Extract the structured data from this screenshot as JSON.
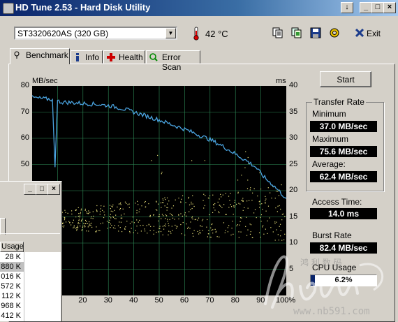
{
  "window": {
    "title": "HD Tune 2.53 - Hard Disk Utility"
  },
  "toolbar": {
    "drive": "ST3320620AS (320 GB)",
    "temperature": "42 °C",
    "exit_label": "Exit"
  },
  "tabs": [
    {
      "label": "Benchmark",
      "icon": "benchmark-icon"
    },
    {
      "label": "Info",
      "icon": "info-icon"
    },
    {
      "label": "Health",
      "icon": "health-icon"
    },
    {
      "label": "Error Scan",
      "icon": "error-scan-icon"
    }
  ],
  "side": {
    "start_label": "Start",
    "transfer_rate_title": "Transfer Rate",
    "minimum_label": "Minimum",
    "minimum_value": "37.0 MB/sec",
    "maximum_label": "Maximum",
    "maximum_value": "75.6 MB/sec",
    "average_label": "Average:",
    "average_value": "62.4 MB/sec",
    "access_time_label": "Access Time:",
    "access_time_value": "14.0 ms",
    "burst_rate_label": "Burst Rate",
    "burst_rate_value": "82.4 MB/sec",
    "cpu_usage_label": "CPU Usage",
    "cpu_usage_value": "6.2%",
    "cpu_usage_fraction": 0.062
  },
  "chart_data": {
    "type": "line",
    "left_unit": "MB/sec",
    "right_unit": "ms",
    "left_ticks": [
      "80",
      "70",
      "60",
      "50"
    ],
    "right_ticks": [
      "40",
      "35",
      "30",
      "25",
      "20",
      "15",
      "10",
      "5"
    ],
    "x_ticks": [
      "20",
      "30",
      "40",
      "50",
      "60",
      "70",
      "80",
      "90",
      "100%"
    ],
    "ylim_left": [
      0,
      80
    ],
    "ylim_right": [
      0,
      40
    ],
    "xlim": [
      0,
      100
    ],
    "colors": {
      "transfer": "#4aa3df",
      "access": "#e8e07a",
      "grid": "#2e8b57"
    },
    "series": [
      {
        "x": [
          0,
          3,
          6,
          8,
          9,
          10,
          12,
          16,
          20,
          25,
          30,
          35,
          40,
          45,
          50,
          55,
          60,
          65,
          70,
          75,
          80,
          85,
          88,
          90,
          92,
          95,
          97,
          100
        ],
        "values": [
          75.6,
          75.2,
          75.0,
          74.8,
          49.0,
          74.2,
          73.8,
          73.6,
          73.3,
          73.0,
          72.5,
          71.5,
          70.0,
          68.5,
          67.0,
          65.2,
          63.5,
          61.5,
          59.5,
          57.0,
          54.0,
          51.0,
          49.0,
          46.5,
          44.5,
          42.0,
          40.0,
          37.0
        ]
      }
    ],
    "access_band": {
      "x_start": 10,
      "x_end": 100,
      "y_min_ms": 10,
      "y_max_ms": 21
    }
  },
  "overlay_window": {
    "column_header": "Usage",
    "rows": [
      "28 K",
      "880 K",
      "016 K",
      "572 K",
      "112 K",
      "968 K",
      "412 K"
    ],
    "selected_index": 1
  }
}
